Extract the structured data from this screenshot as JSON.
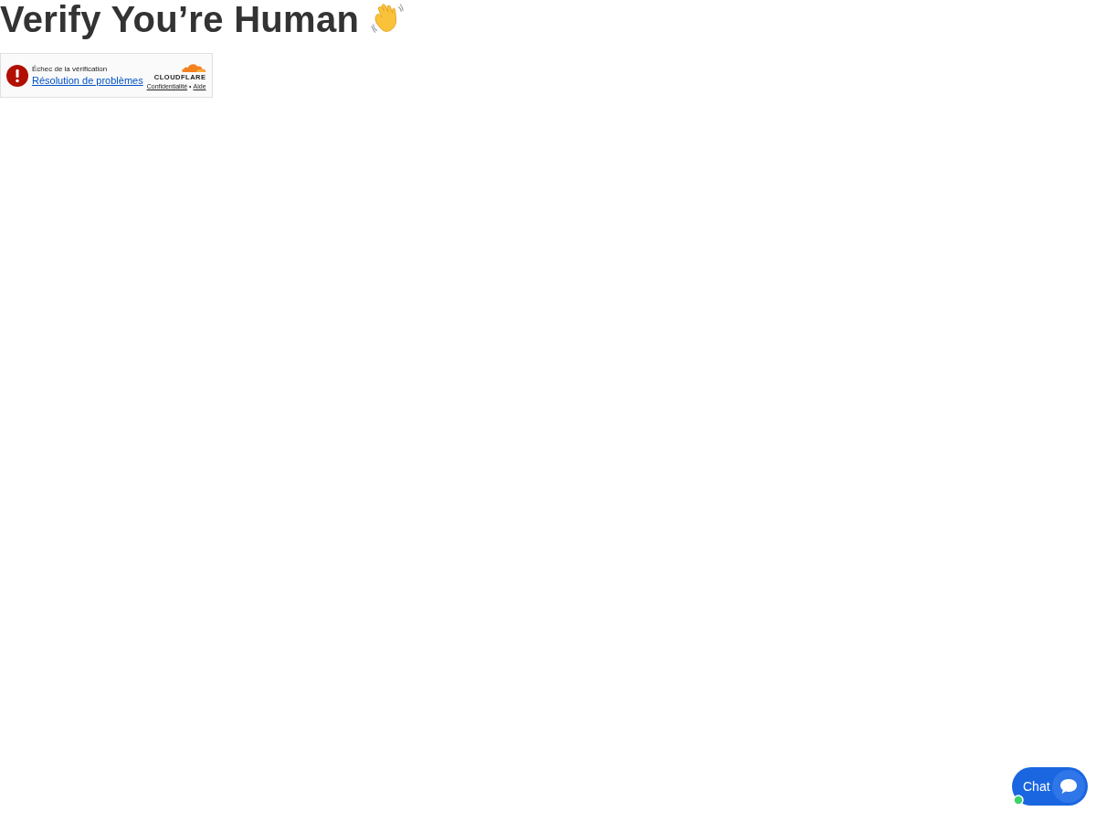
{
  "heading": {
    "text": "Verify You’re Human"
  },
  "challenge": {
    "status": "Échec de la vérification",
    "link": "Résolution de problèmes",
    "logo_text": "CLOUDFLARE",
    "footer_links": [
      "Confidentialité",
      "Aide"
    ],
    "separator": "•"
  },
  "chat": {
    "label": "Chat",
    "online": true
  }
}
